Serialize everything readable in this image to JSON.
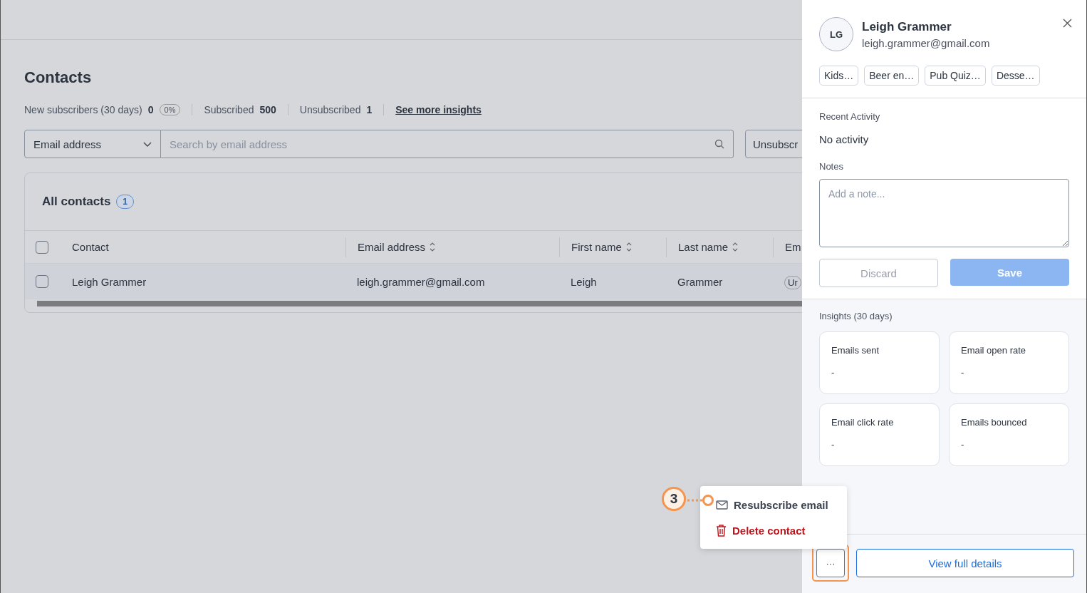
{
  "page": {
    "title": "Contacts",
    "stats": [
      {
        "label": "New subscribers (30 days)",
        "value": "0",
        "badge": "0%"
      },
      {
        "label": "Subscribed",
        "value": "500"
      },
      {
        "label": "Unsubscribed",
        "value": "1"
      }
    ],
    "insights_link": "See more insights",
    "filter": {
      "field": "Email address",
      "placeholder": "Search by email address",
      "button": "Unsubscr"
    },
    "table": {
      "title": "All contacts",
      "count": "1",
      "columns": [
        {
          "label": "Contact",
          "sortable": false
        },
        {
          "label": "Email address",
          "sortable": true
        },
        {
          "label": "First name",
          "sortable": true
        },
        {
          "label": "Last name",
          "sortable": true
        },
        {
          "label": "Em",
          "sortable": false
        }
      ],
      "all_checked": false,
      "rows": [
        {
          "checked": false,
          "cells": [
            "Leigh Grammer",
            "leigh.grammer@gmail.com",
            "Leigh",
            "Grammer"
          ],
          "status": "Ur"
        }
      ]
    }
  },
  "panel": {
    "initials": "LG",
    "name": "Leigh Grammer",
    "email": "leigh.grammer@gmail.com",
    "tags": [
      "Kids…",
      "Beer en…",
      "Pub Quiz…",
      "Desse…"
    ],
    "recent_label": "Recent Activity",
    "recent_value": "No activity",
    "notes_label": "Notes",
    "notes_placeholder": "Add a note...",
    "discard": "Discard",
    "save": "Save",
    "insights_title": "Insights (30 days)",
    "insights": [
      {
        "label": "Emails sent",
        "value": "-"
      },
      {
        "label": "Email open rate",
        "value": "-"
      },
      {
        "label": "Email click rate",
        "value": "-"
      },
      {
        "label": "Emails bounced",
        "value": "-"
      }
    ],
    "more": "···",
    "view_details": "View full details"
  },
  "menu": [
    {
      "kind": "mail",
      "label": "Resubscribe email"
    },
    {
      "kind": "delete",
      "label": "Delete contact"
    }
  ],
  "callout": "3"
}
